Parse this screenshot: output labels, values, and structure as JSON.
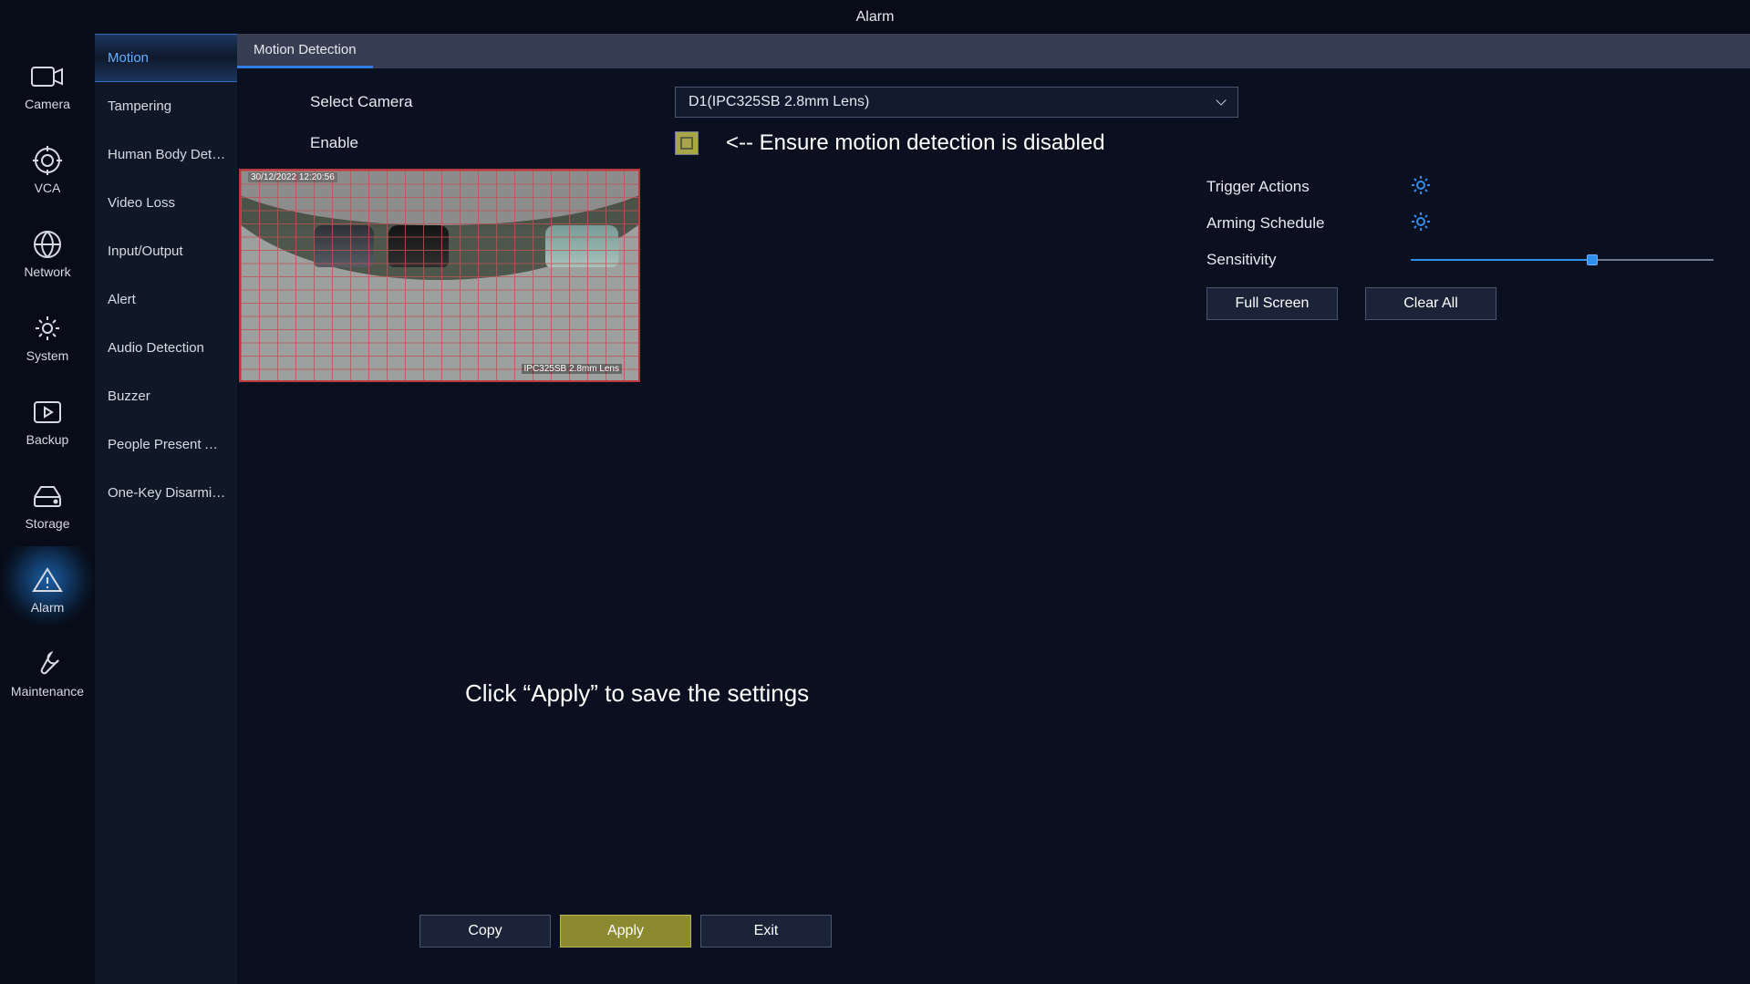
{
  "title": "Alarm",
  "rail": [
    {
      "label": "Camera"
    },
    {
      "label": "VCA"
    },
    {
      "label": "Network"
    },
    {
      "label": "System"
    },
    {
      "label": "Backup"
    },
    {
      "label": "Storage"
    },
    {
      "label": "Alarm"
    },
    {
      "label": "Maintenance"
    }
  ],
  "rail_active": 6,
  "subnav": [
    "Motion",
    "Tampering",
    "Human Body Detecti..",
    "Video Loss",
    "Input/Output",
    "Alert",
    "Audio Detection",
    "Buzzer",
    "People Present Alarm",
    "One-Key Disarming"
  ],
  "subnav_active": 0,
  "tab": "Motion Detection",
  "labels": {
    "select_camera": "Select Camera",
    "enable": "Enable",
    "trigger": "Trigger Actions",
    "schedule": "Arming Schedule",
    "sensitivity": "Sensitivity",
    "full_screen": "Full Screen",
    "clear_all": "Clear All"
  },
  "camera_value": "D1(IPC325SB 2.8mm Lens)",
  "enable_checked": false,
  "preview": {
    "timestamp": "30/12/2022 12:20:56",
    "camera_label": "IPC325SB 2.8mm Lens"
  },
  "sensitivity_percent": 60,
  "annotations": {
    "enable": "<-- Ensure motion detection is disabled",
    "apply": "Click “Apply” to save the settings"
  },
  "footer": {
    "copy": "Copy",
    "apply": "Apply",
    "exit": "Exit"
  }
}
